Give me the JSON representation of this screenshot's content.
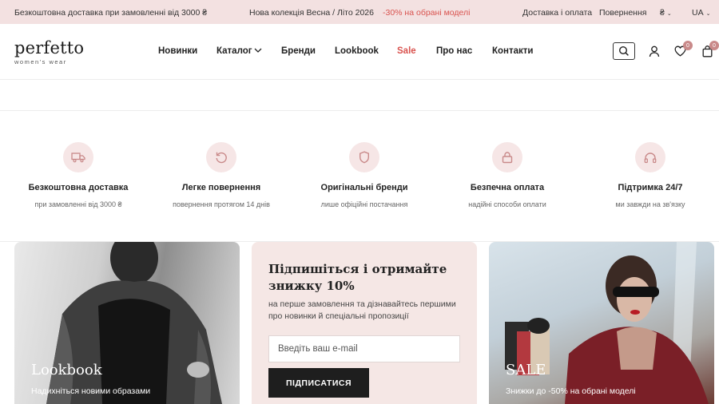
{
  "topbar": {
    "shipping": "Безкоштовна доставка при замовленні від 3000 ₴",
    "collection": "Нова колекція Весна / Літо 2026",
    "promo": "-30% на обрані моделі",
    "delivery_link": "Доставка і оплата",
    "returns_link": "Повернення",
    "currency": "₴",
    "language": "UA",
    "accent_color": "#d9534f"
  },
  "header": {
    "logo": "perfetto",
    "tagline": "women's wear",
    "nav": [
      "Новинки",
      "Каталог",
      "Бренди",
      "Lookbook",
      "Sale",
      "Про нас",
      "Контакти"
    ],
    "wishlist_count": "0",
    "cart_count": "0",
    "icons": [
      "search-icon",
      "user-icon",
      "heart-icon",
      "bag-icon"
    ]
  },
  "features": [
    {
      "icon": "truck-icon",
      "title": "Безкоштовна доставка",
      "subtitle": "при замовленні від 3000 ₴"
    },
    {
      "icon": "return-icon",
      "title": "Легке повернення",
      "subtitle": "повернення протягом 14 днів"
    },
    {
      "icon": "shield-icon",
      "title": "Оригінальні бренди",
      "subtitle": "лише офіційні постачання"
    },
    {
      "icon": "lock-icon",
      "title": "Безпечна оплата",
      "subtitle": "надійні способи оплати"
    },
    {
      "icon": "headphones-icon",
      "title": "Підтримка 24/7",
      "subtitle": "ми завжди на зв'язку"
    }
  ],
  "cards": {
    "lookbook": {
      "title": "Lookbook",
      "subtitle": "Надихніться новими образами"
    },
    "subscribe": {
      "title": "Підпишіться і отримайте знижку 10%",
      "text": "на перше замовлення та дізнавайтесь першими про новинки й спеціальні пропозиції",
      "placeholder": "Введіть ваш e-mail",
      "button": "ПІДПИСАТИСЯ"
    },
    "sale": {
      "title": "SALE",
      "subtitle": "Знижки до -50% на обрані моделі"
    }
  }
}
